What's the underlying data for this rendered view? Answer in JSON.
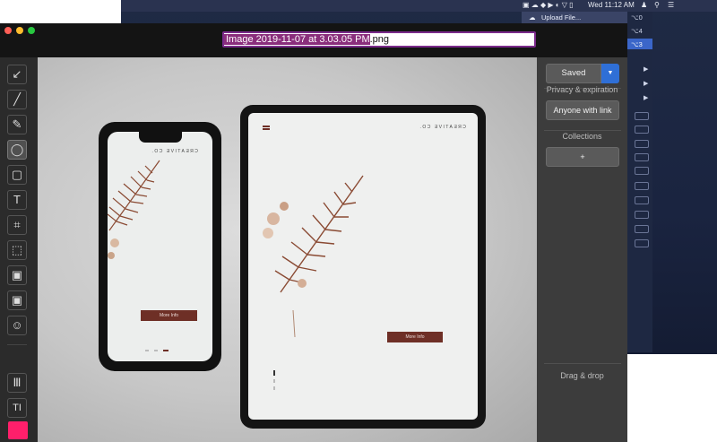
{
  "menubar": {
    "datetime": "Wed 11:12 AM",
    "upload_menu_item": "Upload File..."
  },
  "shortcuts": [
    "⌥0",
    "⌥4",
    "⌥3"
  ],
  "window": {
    "filename_selected": "Image 2019-11-07 at 3.03.05 PM",
    "filename_ext": ".png"
  },
  "tools": [
    {
      "name": "arrow-tool",
      "icon": "↙"
    },
    {
      "name": "line-tool",
      "icon": "╱"
    },
    {
      "name": "marker-tool",
      "icon": "✎"
    },
    {
      "name": "ellipse-tool",
      "icon": "◯"
    },
    {
      "name": "rectangle-tool",
      "icon": "▢"
    },
    {
      "name": "text-tool",
      "icon": "T"
    },
    {
      "name": "crop-tool",
      "icon": "⌗"
    },
    {
      "name": "dashed-rect-tool",
      "icon": "⬚"
    },
    {
      "name": "highlight-tool",
      "icon": "▣"
    },
    {
      "name": "blur-tool",
      "icon": "▣"
    },
    {
      "name": "emoji-tool",
      "icon": "☺"
    },
    {
      "name": "stroke-width-tool",
      "icon": "Ⅲ"
    },
    {
      "name": "font-size-tool",
      "icon": "TI"
    }
  ],
  "mockup": {
    "brand": "CREATIVE CO.",
    "button": "More Info"
  },
  "share_panel": {
    "saved_label": "Saved",
    "privacy_heading": "Privacy & expiration",
    "privacy_button": "Anyone with link",
    "collections_heading": "Collections",
    "add_collection": "+",
    "drag_drop": "Drag & drop"
  },
  "colors": {
    "accent_blue": "#2f6fd6",
    "selection_purple": "#8a2e7c",
    "current_color": "#ff1f6b",
    "mockup_button": "#6e2f26"
  }
}
